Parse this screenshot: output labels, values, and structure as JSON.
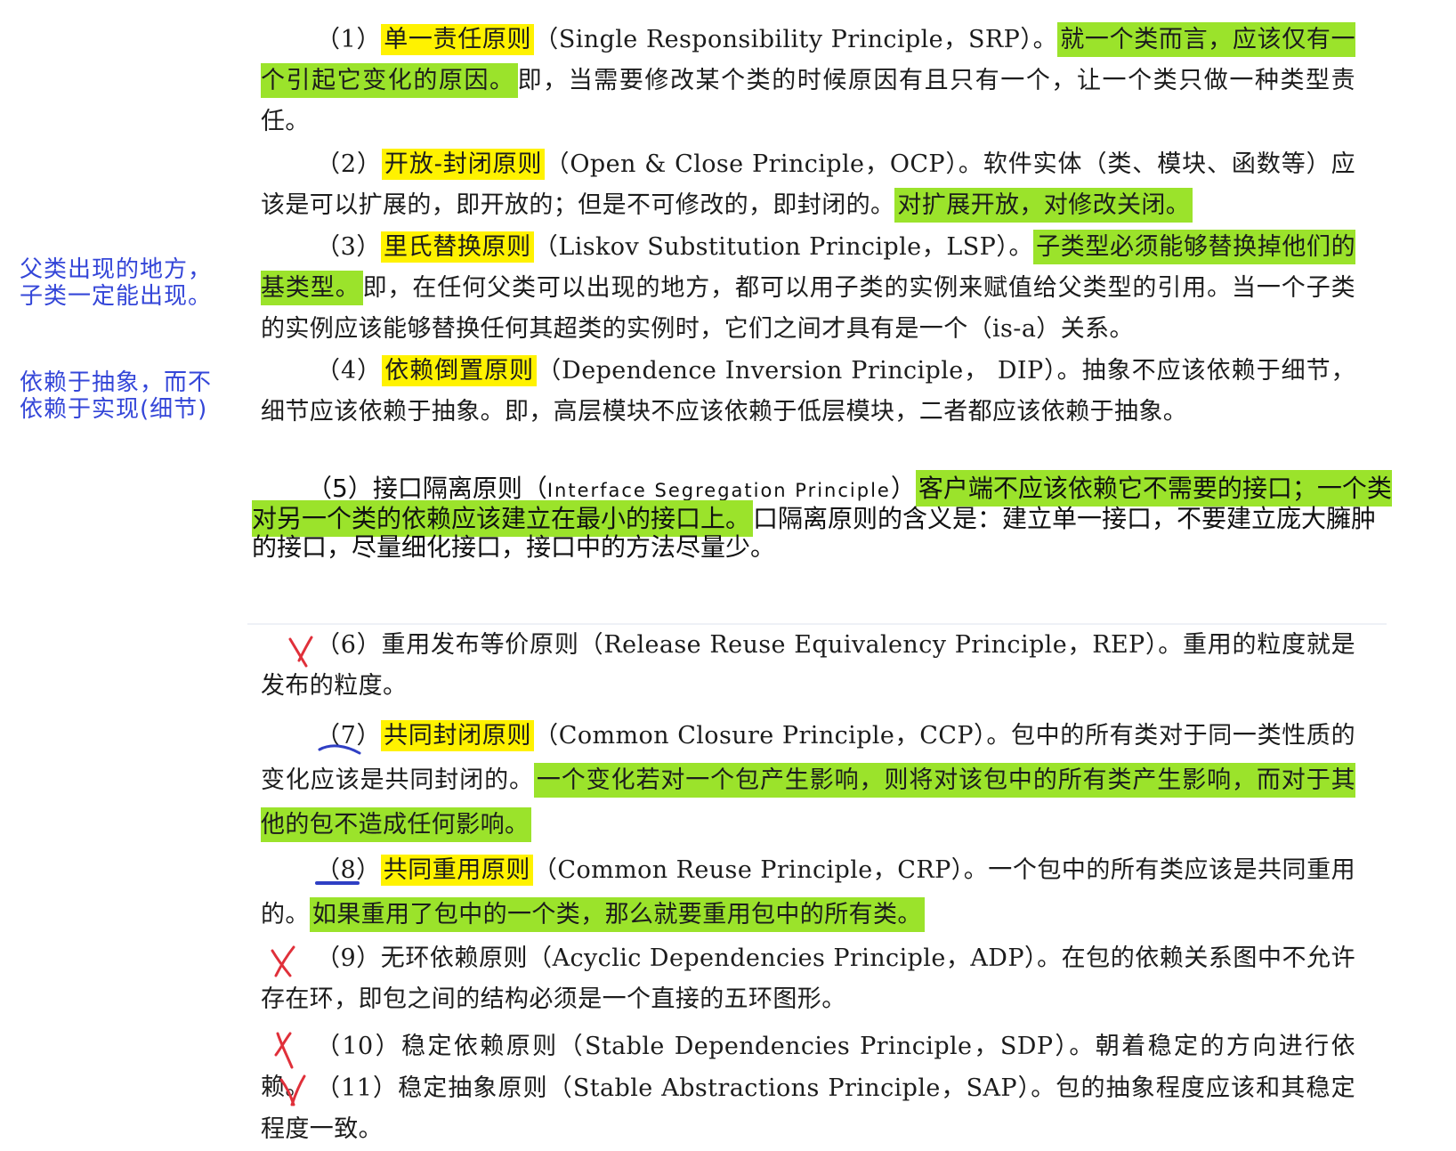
{
  "notes": {
    "note1_line1": "父类出现的地方，",
    "note1_line2": "子类一定能出现。",
    "note2_line1": "依赖于抽象，而不",
    "note2_line2": "依赖于实现(细节)"
  },
  "p1": {
    "num": "（1）",
    "name": "单一责任原则",
    "en": "（Single Responsibility Principle，SRP）。",
    "key": "就一个类而言，应该仅有一个引起它变化的原因。",
    "rest": "即，当需要修改某个类的时候原因有且只有一个，让一个类只做一种类型责任。"
  },
  "p2": {
    "num": "（2）",
    "name": "开放-封闭原则",
    "en": "（Open & Close Principle，OCP）。软件实体（类、模块、函数等）应该是可以扩展的，即开放的；但是不可修改的，即封闭的。",
    "key": "对扩展开放，对修改关闭。"
  },
  "p3": {
    "num": "（3）",
    "name": "里氏替换原则",
    "en": "（Liskov Substitution Principle，LSP）。",
    "key": "子类型必须能够替换掉他们的基类型。",
    "rest": "即，在任何父类可以出现的地方，都可以用子类的实例来赋值给父类型的引用。当一个子类的实例应该能够替换任何其超类的实例时，它们之间才具有是一个（is-a）关系。"
  },
  "p4": {
    "num": "（4）",
    "name": "依赖倒置原则",
    "rest": "（Dependence Inversion Principle， DIP）。抽象不应该依赖于细节，细节应该依赖于抽象。即，高层模块不应该依赖于低层模块，二者都应该依赖于抽象。"
  },
  "p5": {
    "lead": "（5）接口隔离原则（",
    "en": "Interface Segregation Principle",
    "close": "）",
    "key": "客户端不应该依赖它不需要的接口；一个类对另一个类的依赖应该建立在最小的接口上。",
    "rest": "口隔离原则的含义是：建立单一接口，不要建立庞大臃肿的接口，尽量细化接口，接口中的方法尽量少。"
  },
  "p6": {
    "text": "（6）重用发布等价原则（Release Reuse Equivalency Principle，REP）。重用的粒度就是发布的粒度。"
  },
  "p7": {
    "num": "（7）",
    "name": "共同封闭原则",
    "en": "（Common Closure Principle，CCP）。包中的所有类对于同一类性质的变化应该是共同封闭的。",
    "key": "一个变化若对一个包产生影响，则将对该包中的所有类产生影响，而对于其他的包不造成任何影响。"
  },
  "p8": {
    "num": "（8）",
    "name": "共同重用原则",
    "en": "（Common Reuse Principle，CRP）。一个包中的所有类应该是共同重用的。",
    "key": "如果重用了包中的一个类，那么就要重用包中的所有类。"
  },
  "p9": {
    "text": "（9）无环依赖原则（Acyclic Dependencies Principle，ADP）。在包的依赖关系图中不允许存在环，即包之间的结构必须是一个直接的五环图形。"
  },
  "p10": {
    "text": "（10）稳定依赖原则（Stable Dependencies Principle，SDP）。朝着稳定的方向进行依赖。"
  },
  "p11": {
    "text": "（11）稳定抽象原则（Stable Abstractions Principle，SAP）。包的抽象程度应该和其稳定程度一致。"
  },
  "colors": {
    "yellow_highlight": "#fff200",
    "green_highlight": "#9be32b",
    "note_blue": "#3446d8",
    "cross_red": "#e0303a",
    "underline_blue": "#2f3fc4"
  }
}
